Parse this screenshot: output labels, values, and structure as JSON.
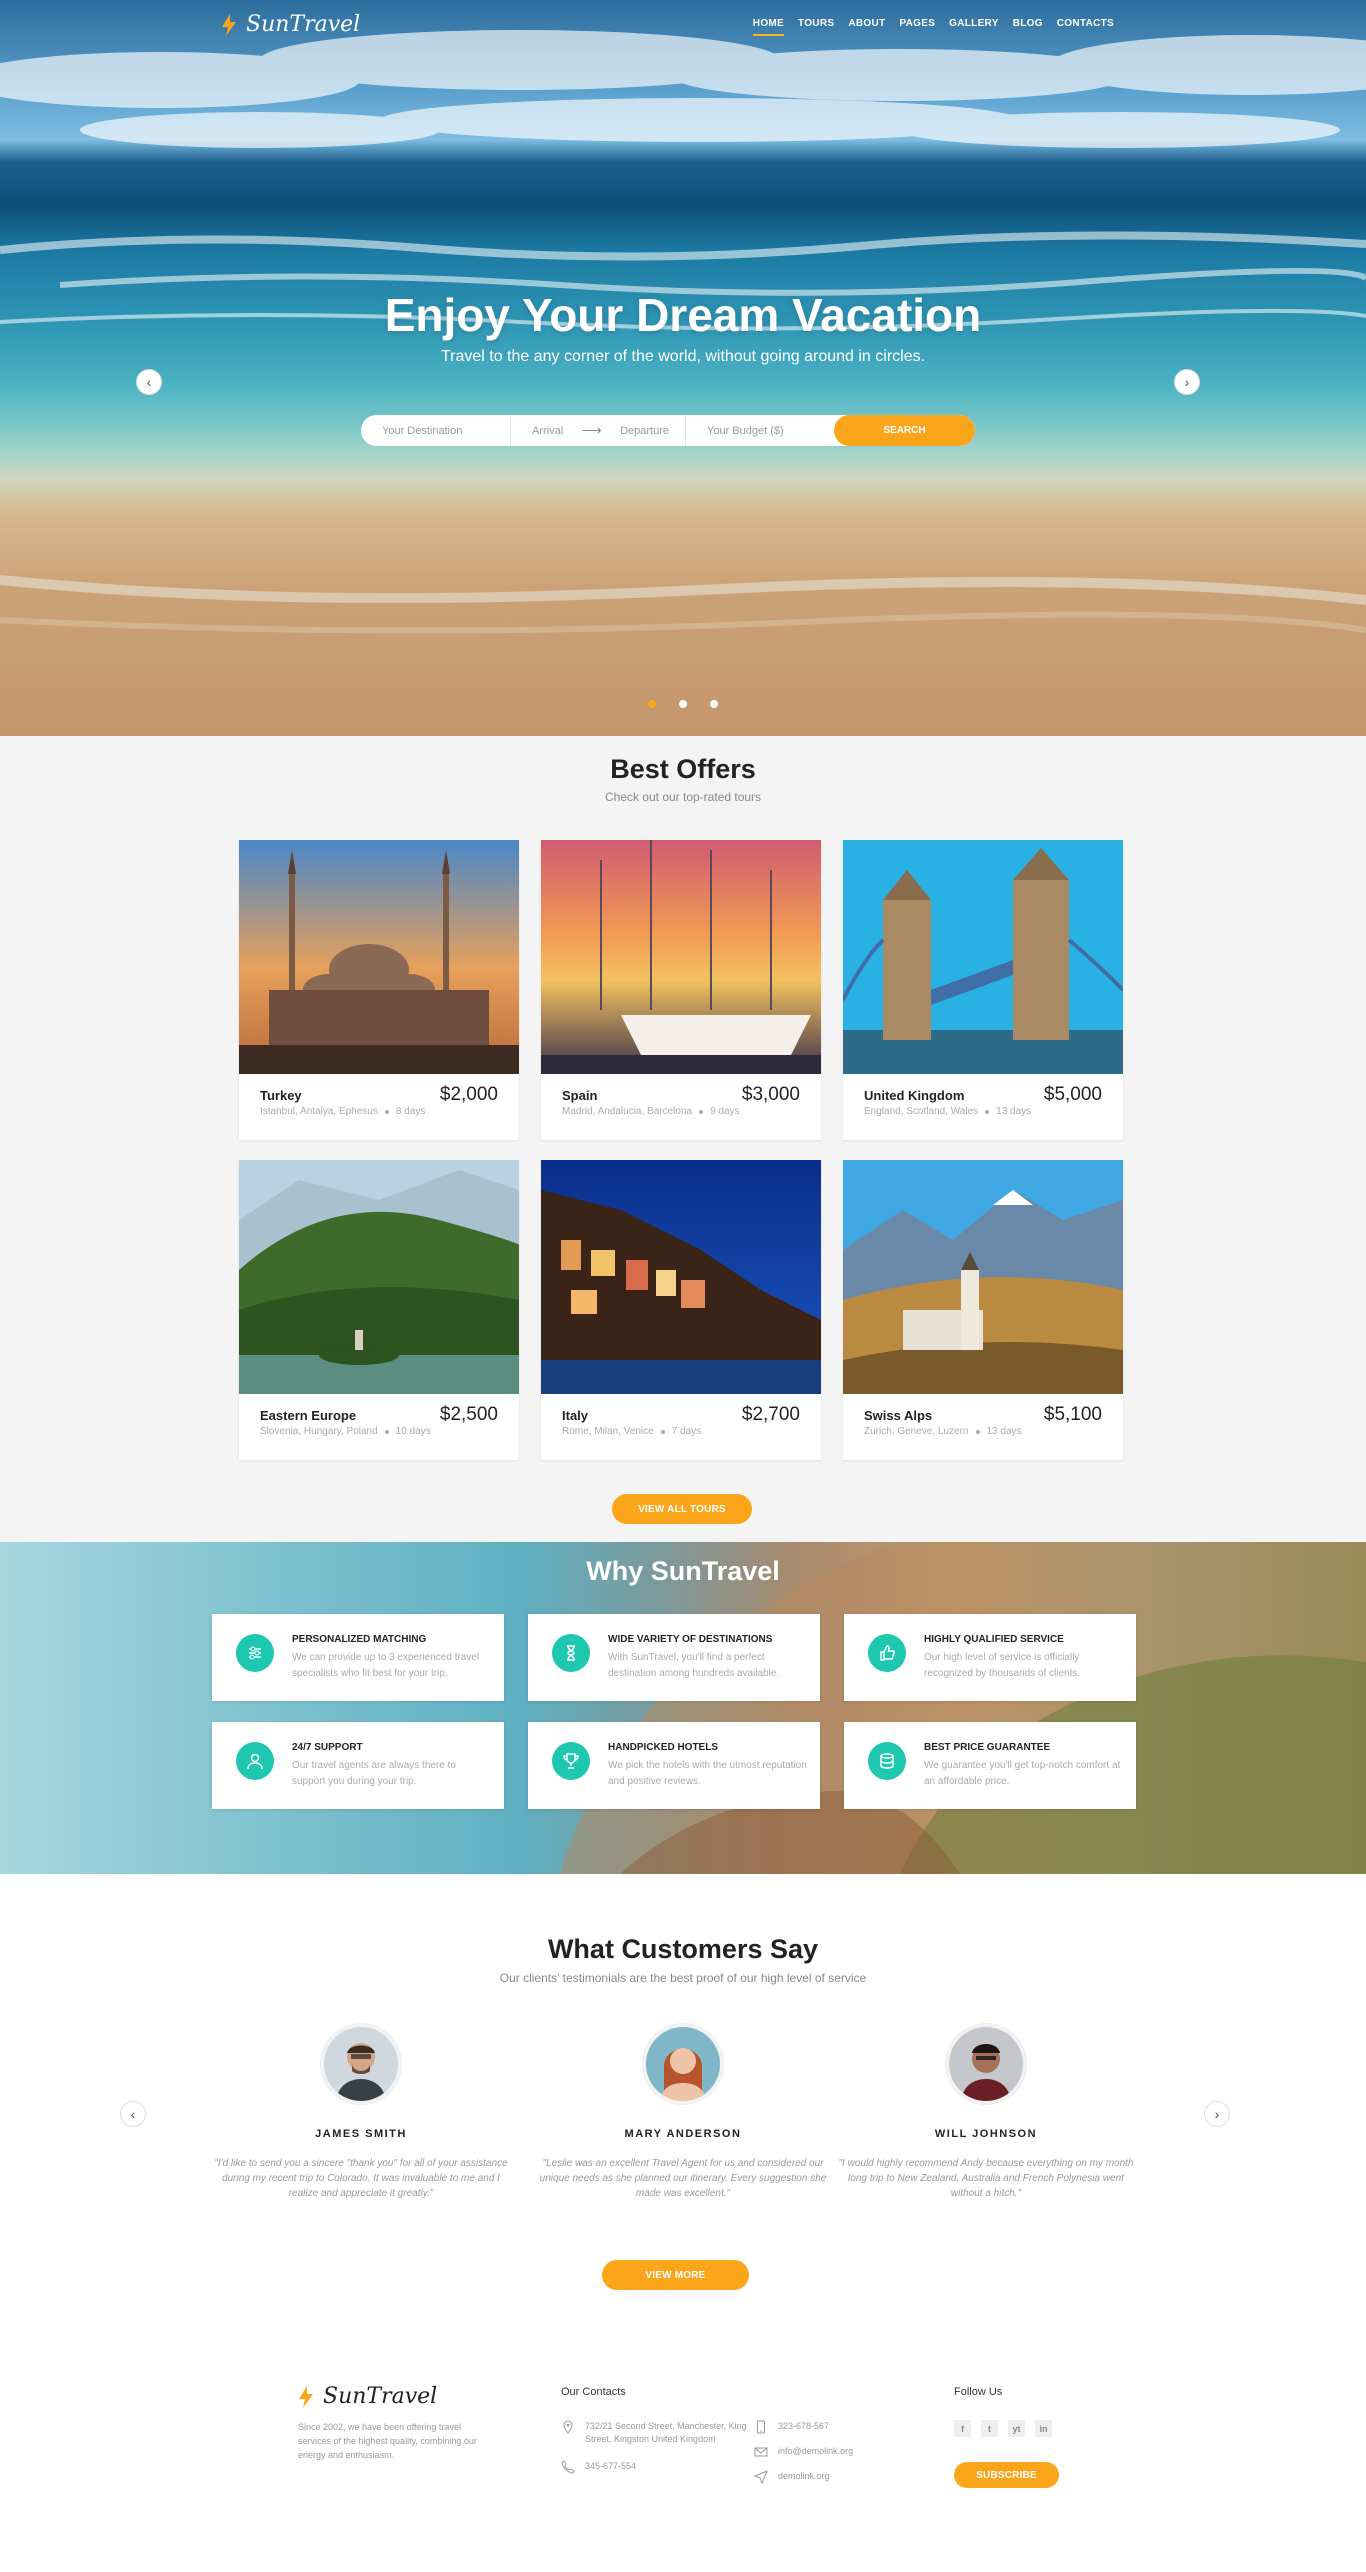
{
  "brand": {
    "name": "SunTravel",
    "accent": "#fba51a",
    "teal": "#1ec7b0"
  },
  "nav": {
    "items": [
      {
        "label": "HOME"
      },
      {
        "label": "TOURS"
      },
      {
        "label": "ABOUT"
      },
      {
        "label": "PAGES"
      },
      {
        "label": "GALLERY"
      },
      {
        "label": "BLOG"
      },
      {
        "label": "CONTACTS"
      }
    ],
    "active": "HOME"
  },
  "hero": {
    "title": "Enjoy Your Dream Vacation",
    "subtitle": "Travel to the any corner of the world, without going around in circles.",
    "search": {
      "destination_placeholder": "Your Destination",
      "arrival_placeholder": "Arrival",
      "departure_placeholder": "Departure",
      "budget_placeholder": "Your Budget ($)",
      "button": "SEARCH"
    },
    "slides": 3,
    "active_slide": 1
  },
  "offers": {
    "title": "Best Offers",
    "subtitle": "Check out our top-rated tours",
    "cards": [
      {
        "name": "Turkey",
        "price": "$2,000",
        "places": "Istanbul, Antalya, Ephesus",
        "days": "8 days"
      },
      {
        "name": "Spain",
        "price": "$3,000",
        "places": "Madrid, Andalucia, Barcelona",
        "days": "9 days"
      },
      {
        "name": "United Kingdom",
        "price": "$5,000",
        "places": "England, Scotland, Wales",
        "days": "13 days"
      },
      {
        "name": "Eastern Europe",
        "price": "$2,500",
        "places": "Slovenia, Hungary, Poland",
        "days": "10 days"
      },
      {
        "name": "Italy",
        "price": "$2,700",
        "places": "Rome, Milan, Venice",
        "days": "7 days"
      },
      {
        "name": "Swiss Alps",
        "price": "$5,100",
        "places": "Zurich, Geneve, Luzern",
        "days": "13 days"
      }
    ],
    "button": "VIEW ALL TOURS"
  },
  "why": {
    "title": "Why SunTravel",
    "features": [
      {
        "title": "PERSONALIZED MATCHING",
        "text": "We can provide up to 3 experienced travel specialists who fit best for your trip.",
        "icon": "sliders-icon"
      },
      {
        "title": "WIDE VARIETY OF DESTINATIONS",
        "text": "With SunTravel, you'll find a perfect destination among hundreds available.",
        "icon": "hourglass-icon"
      },
      {
        "title": "HIGHLY QUALIFIED SERVICE",
        "text": "Our high level of service is officially recognized by thousands of clients.",
        "icon": "thumbs-up-icon"
      },
      {
        "title": "24/7 SUPPORT",
        "text": "Our travel agents are always there to support you during your trip.",
        "icon": "user-icon"
      },
      {
        "title": "HANDPICKED HOTELS",
        "text": "We pick the hotels with the utmost reputation and positive reviews.",
        "icon": "trophy-icon"
      },
      {
        "title": "BEST PRICE GUARANTEE",
        "text": "We guarantee you'll get top-notch comfort at an affordable price.",
        "icon": "coins-icon"
      }
    ]
  },
  "testimonials": {
    "title": "What Customers Say",
    "subtitle": "Our clients' testimonials are the best proof of our high level of service",
    "people": [
      {
        "name": "JAMES SMITH",
        "quote": "\"I'd like to send you a sincere \"thank you\" for all of your assistance during my recent trip to Colorado. It was invaluable to me and I realize and appreciate it greatly.\""
      },
      {
        "name": "MARY ANDERSON",
        "quote": "\"Leslie was an excellent Travel Agent for us and considered our unique needs as she planned our itinerary. Every suggestion she made was excellent.\""
      },
      {
        "name": "WILL JOHNSON",
        "quote": "\"I would highly recommend Andy because everything on my month long trip to New Zealand, Australia and French Polynesia went without a hitch.\""
      }
    ],
    "button": "VIEW MORE"
  },
  "footer": {
    "about": "Since 2002, we have been offering travel services of the highest quality, combining our energy and enthusiasm.",
    "contacts_title": "Our Contacts",
    "address": "732/21 Second Street, Manchester, King Street, Kingston United Kingdom",
    "phone1": "345-677-554",
    "phone2": "323-678-567",
    "email": "info@demolink.org",
    "website": "demolink.org",
    "follow_title": "Follow Us",
    "social": [
      "f",
      "t",
      "yt",
      "in"
    ],
    "subscribe": "SUBSCRIBE"
  }
}
